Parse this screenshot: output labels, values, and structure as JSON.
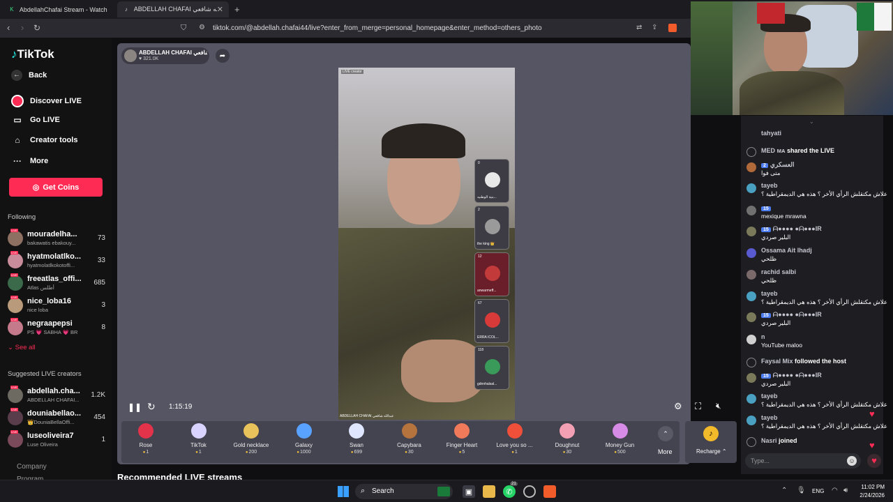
{
  "browser": {
    "tabs": [
      {
        "title": "AbdellahChafai Stream - Watch Live"
      },
      {
        "title": "ABDELLAH CHAFAI عبدالله شافعي"
      }
    ],
    "url": "tiktok.com/@abdellah.chafai44/live?enter_from_merge=personal_homepage&enter_method=others_photo"
  },
  "sidebar": {
    "logo": "TikTok",
    "back": "Back",
    "menu": [
      {
        "label": "Discover LIVE"
      },
      {
        "label": "Go LIVE"
      },
      {
        "label": "Creator tools"
      },
      {
        "label": "More"
      }
    ],
    "get_coins": "Get Coins",
    "following_title": "Following",
    "following": [
      {
        "name": "mouradelha...",
        "sub": "bakawatis ebakouy...",
        "count": "73"
      },
      {
        "name": "hyatmolatlko...",
        "sub": "hyatmolatlkokotoffi...",
        "count": "33"
      },
      {
        "name": "freeatlas_offi...",
        "sub": "Atlas أطلس",
        "count": "685"
      },
      {
        "name": "nice_loba16",
        "sub": "nice loba",
        "count": "3"
      },
      {
        "name": "negraapepsi",
        "sub": "PS 💗 SABHA 💗 BR",
        "count": "8"
      }
    ],
    "see_all": "See all",
    "suggested_title": "Suggested LIVE creators",
    "suggested": [
      {
        "name": "abdellah.cha...",
        "sub": "ABDELLAH CHAFAI...",
        "count": "1.2K"
      },
      {
        "name": "douniabellao...",
        "sub": "👑DouniaBellaOffi...",
        "count": "454"
      },
      {
        "name": "luseoliveira7",
        "sub": "Luse Oliveira",
        "count": "1"
      }
    ],
    "footer": [
      "Company",
      "Program"
    ]
  },
  "host": {
    "name": "ABDELLAH CHAFAI عبدالله شافعي",
    "likes": "321.0K"
  },
  "video": {
    "tag": "LIVE creator",
    "watermark": "ABDELLAH CHAFAI عبدالله شافعي",
    "guests": [
      {
        "num": "0",
        "name": "بنية الوطنيه..."
      },
      {
        "num": "2",
        "name": "the king 👑"
      },
      {
        "num": "12",
        "name": "anwarmeff..."
      },
      {
        "num": "67",
        "name": "ERRA ICOL..."
      },
      {
        "num": "118",
        "name": "gdnnhalsal..."
      }
    ]
  },
  "controls": {
    "time": "1:15:19"
  },
  "gifts": [
    {
      "name": "Rose",
      "price": "1",
      "color": "#e2334b"
    },
    {
      "name": "TikTok",
      "price": "1",
      "color": "#d8d4ff"
    },
    {
      "name": "Gold necklace",
      "price": "200",
      "color": "#e8c25a"
    },
    {
      "name": "Galaxy",
      "price": "1000",
      "color": "#5aa2ff"
    },
    {
      "name": "Swan",
      "price": "699",
      "color": "#dfe6ff"
    },
    {
      "name": "Capybara",
      "price": "30",
      "color": "#b5733d"
    },
    {
      "name": "Finger Heart",
      "price": "5",
      "color": "#f07a5a"
    },
    {
      "name": "Love you so ...",
      "price": "1",
      "color": "#f0503a"
    },
    {
      "name": "Doughnut",
      "price": "30",
      "color": "#f4a0b4"
    },
    {
      "name": "Money Gun",
      "price": "500",
      "color": "#d68be6"
    }
  ],
  "more_label": "More",
  "recharge_label": "Recharge",
  "recommended": "Recommended LIVE streams",
  "chat": [
    {
      "name": "tahyati",
      "text": ""
    },
    {
      "name": "MED ᴍᴀ",
      "text": "shared the LIVE",
      "inline": true
    },
    {
      "name": "العسكري",
      "text": "متى فوا",
      "badge": "2"
    },
    {
      "name": "tayeb",
      "text": "علاش مكتقلش الرأي الأخر ؟ هذه هي الديمقراطية ؟"
    },
    {
      "name": "",
      "text": "mexique mrawna",
      "badge": "15"
    },
    {
      "name": "ᗩ●●●● ●ᗩ●●●IR",
      "text": "البلير صردي",
      "badge": "15"
    },
    {
      "name": "Ossama Ait lhadj",
      "text": "ظلحي"
    },
    {
      "name": "rachid salbi",
      "text": "ظلحي"
    },
    {
      "name": "tayeb",
      "text": "علاش مكتقلش الرأي الأخر ؟ هذه هي الديمقراطية ؟"
    },
    {
      "name": "ᗩ●●●● ●ᗩ●●●IR",
      "text": "البلير صردي",
      "badge": "15"
    },
    {
      "name": "n",
      "text": "YouTube maloo"
    },
    {
      "name": "Faysal Mix",
      "text": "followed the host",
      "inline": true
    },
    {
      "name": "ᗩ●●●● ●ᗩ●●●IR",
      "text": "البلير صردي",
      "badge": "15"
    },
    {
      "name": "tayeb",
      "text": "علاش مكتقلش الرأي الأخر ؟ هذه هي الديمقراطية ؟"
    },
    {
      "name": "tayeb",
      "text": "علاش مكتقلش الرأي الأخر ؟ هذه هي الديمقراطية ؟"
    },
    {
      "name": "Nasri",
      "text": "joined",
      "inline": true
    }
  ],
  "chat_input_placeholder": "Type...",
  "taskbar": {
    "search": "Search",
    "lang": "ENG",
    "time": "11:02 PM",
    "date": "2/24/2026",
    "wa_badge": "21"
  }
}
